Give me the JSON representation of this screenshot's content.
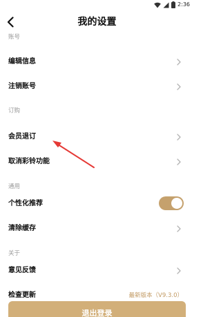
{
  "status_bar": {
    "time": "2:36"
  },
  "header": {
    "title": "我的设置"
  },
  "sections": {
    "account": {
      "label": "账号",
      "items": {
        "edit_info": "编辑信息",
        "cancel_account": "注销账号"
      }
    },
    "subscription": {
      "label": "订购",
      "items": {
        "member_unsubscribe": "会员退订",
        "cancel_ringtone": "取消彩铃功能"
      }
    },
    "general": {
      "label": "通用",
      "items": {
        "personalized": "个性化推荐",
        "clear_cache": "清除缓存"
      },
      "personalized_enabled": true
    },
    "about": {
      "label": "关于",
      "items": {
        "feedback": "意见反馈",
        "check_update": "检查更新"
      },
      "latest_version": "最新版本（V9.3.0）"
    }
  },
  "logout_button": "退出登录",
  "colors": {
    "accent": "#c5a16d",
    "button": "#d2af79",
    "annotation_arrow": "#e53935"
  }
}
